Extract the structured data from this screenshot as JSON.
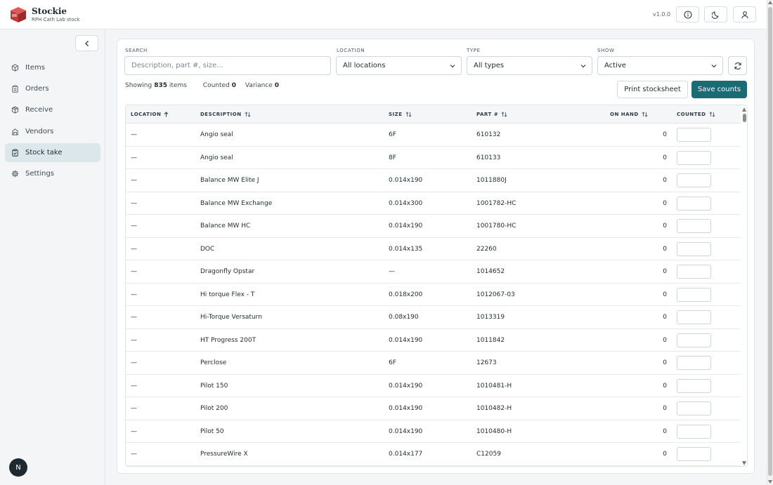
{
  "app": {
    "name": "Stockie",
    "subtitle": "RPH Cath Lab stock",
    "version": "v1.0.0"
  },
  "sidebar": {
    "items": [
      {
        "label": "Items",
        "icon": "box-icon",
        "active": false
      },
      {
        "label": "Orders",
        "icon": "clipboard-icon",
        "active": false
      },
      {
        "label": "Receive",
        "icon": "package-icon",
        "active": false
      },
      {
        "label": "Vendors",
        "icon": "building-icon",
        "active": false
      },
      {
        "label": "Stock take",
        "icon": "clipboard-check-icon",
        "active": true
      },
      {
        "label": "Settings",
        "icon": "gear-icon",
        "active": false
      }
    ],
    "avatar_letter": "N"
  },
  "filters": {
    "search_label": "SEARCH",
    "search_placeholder": "Description, part #, size...",
    "location_label": "LOCATION",
    "location_value": "All locations",
    "type_label": "TYPE",
    "type_value": "All types",
    "show_label": "SHOW",
    "show_value": "Active"
  },
  "stats": {
    "showing_prefix": "Showing",
    "showing_count": "835",
    "showing_suffix": "items",
    "counted_label": "Counted",
    "counted_value": "0",
    "variance_label": "Variance",
    "variance_value": "0"
  },
  "actions": {
    "print_label": "Print stocksheet",
    "save_label": "Save counts"
  },
  "table": {
    "columns": [
      "LOCATION",
      "DESCRIPTION",
      "SIZE",
      "PART #",
      "ON HAND",
      "COUNTED"
    ],
    "rows": [
      {
        "location": "—",
        "description": "Angio seal",
        "size": "6F",
        "part": "610132",
        "on_hand": "0"
      },
      {
        "location": "—",
        "description": "Angio seal",
        "size": "8F",
        "part": "610133",
        "on_hand": "0"
      },
      {
        "location": "—",
        "description": "Balance MW Elite J",
        "size": "0.014x190",
        "part": "1011880J",
        "on_hand": "0"
      },
      {
        "location": "—",
        "description": "Balance MW Exchange",
        "size": "0.014x300",
        "part": "1001782-HC",
        "on_hand": "0"
      },
      {
        "location": "—",
        "description": "Balance MW HC",
        "size": "0.014x190",
        "part": "1001780-HC",
        "on_hand": "0"
      },
      {
        "location": "—",
        "description": "DOC",
        "size": "0.014x135",
        "part": "22260",
        "on_hand": "0"
      },
      {
        "location": "—",
        "description": "Dragonfly Opstar",
        "size": "—",
        "part": "1014652",
        "on_hand": "0"
      },
      {
        "location": "—",
        "description": "Hi torque Flex - T",
        "size": "0.018x200",
        "part": "1012067-03",
        "on_hand": "0"
      },
      {
        "location": "—",
        "description": "Hi-Torque Versaturn",
        "size": "0.08x190",
        "part": "1013319",
        "on_hand": "0"
      },
      {
        "location": "—",
        "description": "HT Progress 200T",
        "size": "0.014x190",
        "part": "1011842",
        "on_hand": "0"
      },
      {
        "location": "—",
        "description": "Perclose",
        "size": "6F",
        "part": "12673",
        "on_hand": "0"
      },
      {
        "location": "—",
        "description": "Pilot 150",
        "size": "0.014x190",
        "part": "1010481-H",
        "on_hand": "0"
      },
      {
        "location": "—",
        "description": "Pilot 200",
        "size": "0.014x190",
        "part": "1010482-H",
        "on_hand": "0"
      },
      {
        "location": "—",
        "description": "Pilot 50",
        "size": "0.014x190",
        "part": "1010480-H",
        "on_hand": "0"
      },
      {
        "location": "—",
        "description": "PressureWire X",
        "size": "0.014x177",
        "part": "C12059",
        "on_hand": "0"
      }
    ]
  },
  "colors": {
    "accent": "#1a6b73",
    "active_nav_bg": "#dce7ec",
    "logo_red": "#c0393b"
  }
}
